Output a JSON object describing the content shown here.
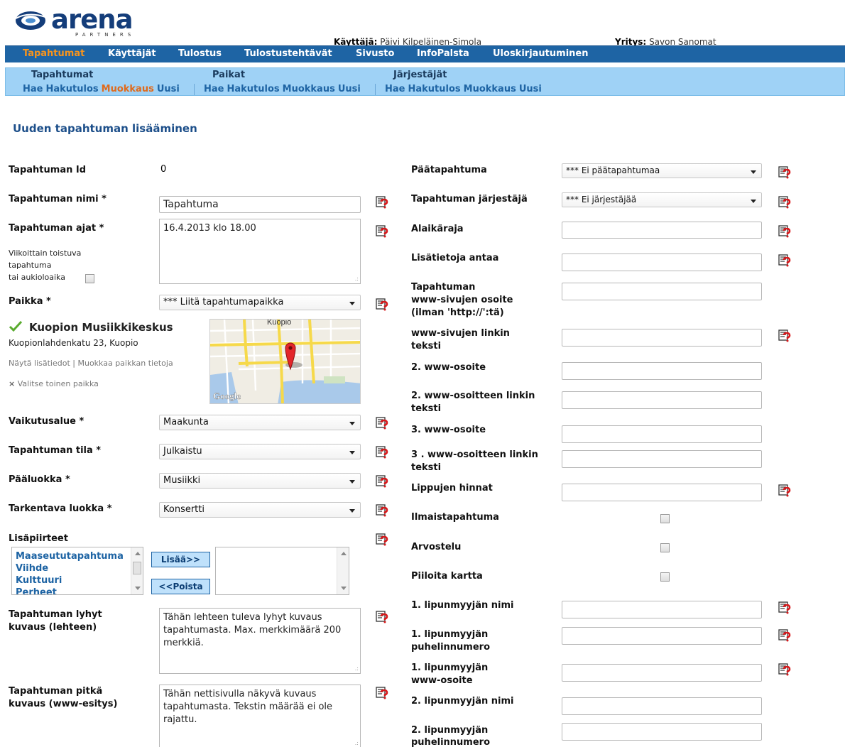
{
  "header": {
    "logo_text": "arena",
    "logo_sub": "PARTNERS",
    "user_label": "Käyttäjä:",
    "user_name": "Päivi Kilpeläinen-Simola",
    "company_label": "Yritys:",
    "company_name": "Savon Sanomat"
  },
  "main_nav": [
    {
      "label": "Tapahtumat"
    },
    {
      "label": "Käyttäjät"
    },
    {
      "label": "Tulostus"
    },
    {
      "label": "Tulostustehtävät"
    },
    {
      "label": "Sivusto"
    },
    {
      "label": "InfoPalsta"
    },
    {
      "label": "Uloskirjautuminen"
    }
  ],
  "sub_nav": [
    {
      "title": "Tapahtumat",
      "links": [
        "Hae",
        "Hakutulos",
        "Muokkaus",
        "Uusi"
      ],
      "current": "Muokkaus"
    },
    {
      "title": "Paikat",
      "links": [
        "Hae",
        "Hakutulos",
        "Muokkaus",
        "Uusi"
      ]
    },
    {
      "title": "Järjestäjät",
      "links": [
        "Hae",
        "Hakutulos",
        "Muokkaus",
        "Uusi"
      ]
    }
  ],
  "page_title": "Uuden tapahtuman lisääminen",
  "left": {
    "id_label": "Tapahtuman Id",
    "id_value": "0",
    "name_label": "Tapahtuman nimi *",
    "name_value": "Tapahtuma",
    "times_label": "Tapahtuman ajat *",
    "times_value": "16.4.2013 klo 18.00",
    "recurring_line1": "Viikoittain toistuva",
    "recurring_line2": "tapahtuma",
    "recurring_line3": "tai aukioloaika",
    "place_label": "Paikka *",
    "place_select": "*** Liitä tapahtumapaikka",
    "venue_name": "Kuopion Musiikkikeskus",
    "venue_address": "Kuopionlahdenkatu 23, Kuopio",
    "venue_show_info": "Näytä lisätiedot",
    "venue_sep": " | ",
    "venue_edit": "Muokkaa paikkan tietoja",
    "venue_other": "Valitse toinen paikka",
    "map_label_city": "Kuopio",
    "map_label_google": "Google",
    "area_label": "Vaikutusalue *",
    "area_value": "Maakunta",
    "state_label": "Tapahtuman tila *",
    "state_value": "Julkaistu",
    "category_label": "Pääluokka *",
    "category_value": "Musiikki",
    "subcategory_label": "Tarkentava luokka *",
    "subcategory_value": "Konsertti",
    "features_label": "Lisäpiirteet",
    "features_items": [
      "Maaseututapahtuma",
      "Viihde",
      "Kulttuuri",
      "Perheet"
    ],
    "add_button": "Lisää>>",
    "remove_button": "<<Poista",
    "short_desc_label1": "Tapahtuman lyhyt",
    "short_desc_label2": "kuvaus (lehteen)",
    "short_desc_value": "Tähän lehteen tuleva lyhyt kuvaus tapahtumasta. Max. merkkimäärä 200 merkkiä.",
    "long_desc_label1": "Tapahtuman pitkä",
    "long_desc_label2": "kuvaus (www-esitys)",
    "long_desc_value": "Tähän nettisivulla näkyvä kuvaus tapahtumasta. Tekstin määrää ei ole rajattu."
  },
  "right": {
    "main_event_label": "Päätapahtuma",
    "main_event_value": "*** Ei päätapahtumaa",
    "organizer_label": "Tapahtuman järjestäjä",
    "organizer_value": "*** Ei järjestäjää",
    "age_label": "Alaikäraja",
    "info_label": "Lisätietoja antaa",
    "www_label1": "Tapahtuman",
    "www_label2": "www-sivujen osoite",
    "www_label3": "(ilman 'http://':tä)",
    "www_link_label1": "www-sivujen linkin",
    "www_link_label2": "teksti",
    "www2_label": "2. www-osoite",
    "www2_link_label1": "2. www-osoitteen linkin",
    "www2_link_label2": "teksti",
    "www3_label": "3. www-osoite",
    "www3_link_label1": "3 . www-osoitteen linkin",
    "www3_link_label2": "teksti",
    "prices_label": "Lippujen hinnat",
    "free_label": "Ilmaistapahtuma",
    "review_label": "Arvostelu",
    "hide_map_label": "Piiloita kartta",
    "seller1_name_label": "1. lipunmyyjän nimi",
    "seller1_phone_label1": "1. lipunmyyjän",
    "seller1_phone_label2": "puhelinnumero",
    "seller1_www_label1": "1. lipunmyyjän",
    "seller1_www_label2": "www-osoite",
    "seller2_name_label": "2. lipunmyyjän nimi",
    "seller2_phone_label1": "2. lipunmyyjän",
    "seller2_phone_label2": "puhelinnumero"
  },
  "colors": {
    "nav_bg": "#1e64a4",
    "nav_active": "#f7941d",
    "subnav_bg": "#9fd2f6",
    "title_blue": "#1d4f8a"
  }
}
